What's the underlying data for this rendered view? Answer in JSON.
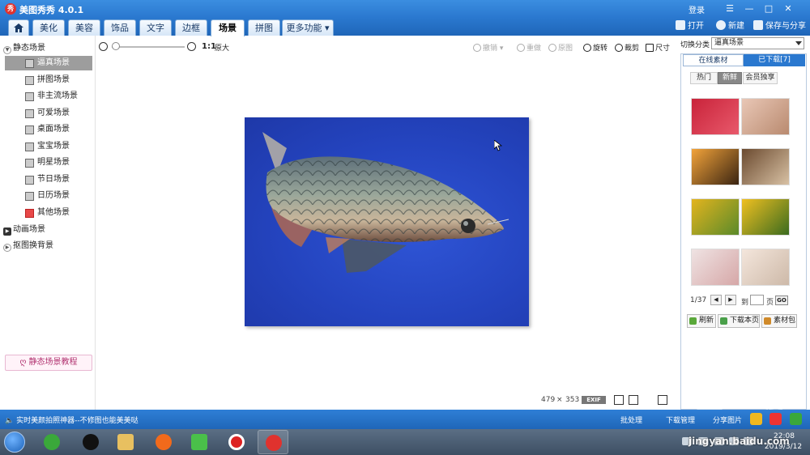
{
  "window": {
    "title": "美图秀秀 4.0.1",
    "logo_text": "秀",
    "login": "登录",
    "controls": [
      "☰",
      "—",
      "□",
      "✕"
    ]
  },
  "tabs": [
    {
      "label": "美化"
    },
    {
      "label": "美容"
    },
    {
      "label": "饰品"
    },
    {
      "label": "文字"
    },
    {
      "label": "边框"
    },
    {
      "label": "场景",
      "active": true
    },
    {
      "label": "拼图"
    },
    {
      "label": "更多功能 ▾"
    }
  ],
  "top_actions": {
    "open": "打开",
    "new": "新建",
    "save_share": "保存与分享"
  },
  "sidebar": {
    "static_group": "静态场景",
    "items": [
      {
        "label": "逼真场景",
        "active": true
      },
      {
        "label": "拼图场景"
      },
      {
        "label": "非主流场景"
      },
      {
        "label": "可爱场景"
      },
      {
        "label": "桌面场景"
      },
      {
        "label": "宝宝场景"
      },
      {
        "label": "明星场景"
      },
      {
        "label": "节日场景"
      },
      {
        "label": "日历场景"
      },
      {
        "label": "其他场景"
      }
    ],
    "animated_group": "动画场景",
    "cutout_group": "抠图换背景",
    "tutorial": "静态场景教程"
  },
  "toolbar": {
    "zoom_value": 0,
    "ratio": "1:1",
    "original": "原大",
    "undo": "撤销",
    "redo": "重做",
    "original_img": "原图",
    "rotate": "旋转",
    "crop": "裁剪",
    "size": "尺寸"
  },
  "canvas": {
    "width": "479",
    "times": "×",
    "height": "353",
    "exif": "EXIF"
  },
  "right_panel": {
    "category_label": "切换分类",
    "category_value": "逼真场景",
    "tab_online": "在线素材",
    "tab_downloaded": "已下载[7]",
    "filters": [
      {
        "label": "热门"
      },
      {
        "label": "新鲜",
        "active": true
      },
      {
        "label": "会员独享"
      }
    ],
    "thumbs": [
      {
        "color_a": "#c9233a",
        "color_b": "#e8596b"
      },
      {
        "color_a": "#e9c7b6",
        "color_b": "#b98a6f"
      },
      {
        "color_a": "#f2a33a",
        "color_b": "#3a2412"
      },
      {
        "color_a": "#6b4a2f",
        "color_b": "#d8c1a4"
      },
      {
        "color_a": "#e3b41e",
        "color_b": "#5a8a2a"
      },
      {
        "color_a": "#f0c020",
        "color_b": "#3b6b1f"
      },
      {
        "color_a": "#efe3e3",
        "color_b": "#d6a7a7"
      },
      {
        "color_a": "#f4e6dc",
        "color_b": "#cdb9a8"
      }
    ],
    "page": "1/37",
    "goto_label": "到",
    "page_suffix": "页",
    "go": "GO",
    "refresh": "刷新",
    "download_page": "下载本页",
    "material_pack": "素材包"
  },
  "statusbar": {
    "message": "实时美颜拍照神器--不修图也能美美哒",
    "batch": "批处理",
    "download_mgr": "下载管理",
    "share_img": "分享图片"
  },
  "taskbar": {
    "time": "22:08",
    "date": "2019/3/12"
  },
  "watermark": {
    "text": "jingyan.baidu.com",
    "brand": "Bai度经验"
  },
  "colors": {
    "title_blue": "#2a78cf",
    "photo_blue": "#2444bf",
    "active_item": "#9d9d9d"
  }
}
